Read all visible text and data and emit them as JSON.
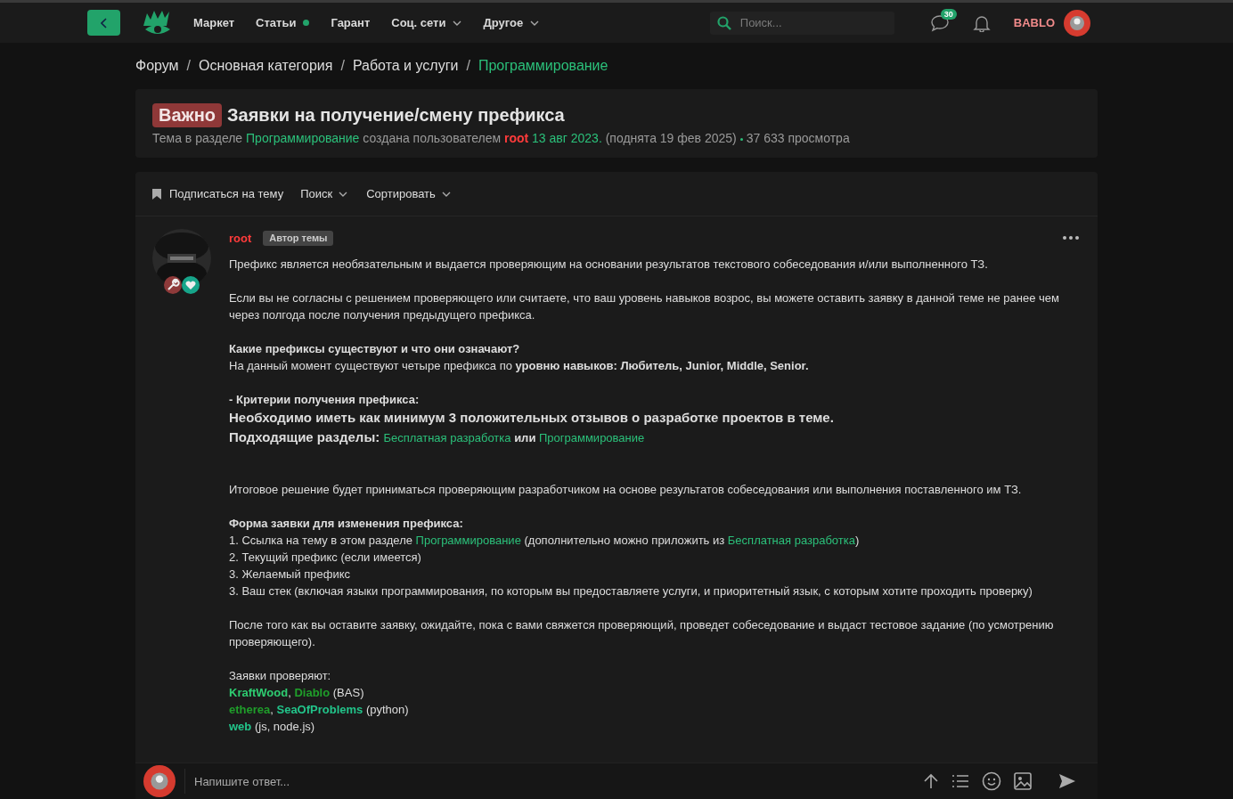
{
  "header": {
    "nav": [
      {
        "label": "Маркет",
        "dot": false,
        "dropdown": false
      },
      {
        "label": "Статьи",
        "dot": true,
        "dropdown": false
      },
      {
        "label": "Гарант",
        "dot": false,
        "dropdown": false
      },
      {
        "label": "Соц. сети",
        "dot": false,
        "dropdown": true
      },
      {
        "label": "Другое",
        "dot": false,
        "dropdown": true
      }
    ],
    "search": {
      "placeholder": "Поиск..."
    },
    "messages_badge": "30",
    "username": "BABLO"
  },
  "breadcrumbs": [
    {
      "label": "Форум",
      "kind": "link",
      "current": false
    },
    {
      "label": "/",
      "kind": "separator"
    },
    {
      "label": "Основная категория",
      "kind": "link",
      "current": false
    },
    {
      "label": "/",
      "kind": "separator"
    },
    {
      "label": "Работа и услуги",
      "kind": "link",
      "current": false
    },
    {
      "label": "/",
      "kind": "separator"
    },
    {
      "label": "Программирование",
      "kind": "link",
      "current": true
    }
  ],
  "topic": {
    "prefix": "Важно",
    "title": "Заявки на получение/смену префикса",
    "meta": [
      {
        "t": "Тема в разделе ",
        "kind": "text"
      },
      {
        "t": "Программирование",
        "kind": "link"
      },
      {
        "t": " создана пользователем ",
        "kind": "text"
      },
      {
        "t": "root",
        "kind": "user",
        "color": "#ff3b3b"
      },
      {
        "t": " 13 авг 2023.",
        "kind": "link"
      },
      {
        "t": " (поднята 19 фев 2025)",
        "kind": "text"
      }
    ],
    "views": "37 633 просмотра"
  },
  "toolbar": [
    {
      "label": "Подписаться на тему",
      "kind": "bookmark"
    },
    {
      "label": "Поиск",
      "kind": "dropdown"
    },
    {
      "label": "Сортировать",
      "kind": "dropdown"
    }
  ],
  "post": {
    "author": "root",
    "author_badge": "Автор темы",
    "body": [
      [
        [
          {
            "t": "Префикс является необязательным и выдается проверяющим на основании результатов текстового собеседования и/или выполненного ТЗ.",
            "kind": "text"
          }
        ]
      ],
      [
        [
          {
            "t": "Если вы не согласны с решением проверяющего или считаете, что ваш уровень навыков возрос, вы можете оставить заявку в данной теме не ранее чем через полгода после получения предыдущего префикса.",
            "kind": "text"
          }
        ]
      ],
      [
        [
          {
            "t": "Какие префиксы существуют и что они означают?",
            "kind": "bold"
          }
        ],
        [
          {
            "t": "На данный момент существуют четыре префикса по ",
            "kind": "text"
          },
          {
            "t": "уровню навыков: Любитель, Junior, Middle, Senior.",
            "kind": "bold"
          }
        ]
      ],
      [
        [
          {
            "t": "- Критерии получения префикса:",
            "kind": "bold"
          }
        ],
        [
          {
            "t": "Необходимо иметь как минимум 3 положительных отзывов о разработке проектов в теме.",
            "kind": "big"
          }
        ],
        [
          {
            "t": "Подходящие разделы: ",
            "kind": "big"
          },
          {
            "t": "Бесплатная разработка",
            "kind": "link"
          },
          {
            "t": " или ",
            "kind": "bold"
          },
          {
            "t": "Программирование",
            "kind": "link"
          }
        ]
      ],
      [
        [
          {
            "t": "Итоговое решение будет приниматься проверяющим разработчиком на основе результатов собеседования или выполнения поставленного им ТЗ.",
            "kind": "text"
          }
        ]
      ],
      [
        [
          {
            "t": "Форма заявки для изменения префикса:",
            "kind": "bold"
          }
        ],
        [
          {
            "t": "1. Ссылка на тему в этом разделе ",
            "kind": "text"
          },
          {
            "t": "Программирование",
            "kind": "link"
          },
          {
            "t": " (дополнительно можно приложить из ",
            "kind": "text"
          },
          {
            "t": "Бесплатная разработка",
            "kind": "link"
          },
          {
            "t": ")",
            "kind": "text"
          }
        ],
        [
          {
            "t": "2. Текущий префикс (если имеется)",
            "kind": "text"
          }
        ],
        [
          {
            "t": "3. Желаемый префикс",
            "kind": "text"
          }
        ],
        [
          {
            "t": "3. Ваш стек (включая языки программирования, по которым вы предоставляете услуги, и приоритетный язык, с которым хотите проходить проверку)",
            "kind": "text"
          }
        ]
      ],
      [
        [
          {
            "t": "После того как вы оставите заявку, ожидайте, пока с вами свяжется проверяющий, проведет собеседование и выдаст тестовое задание (по усмотрению проверяющего).",
            "kind": "text"
          }
        ]
      ],
      [
        [
          {
            "t": "Заявки проверяют:",
            "kind": "text"
          }
        ],
        [
          {
            "t": "KraftWood",
            "kind": "user",
            "color": "#2ecc71"
          },
          {
            "t": ", ",
            "kind": "text"
          },
          {
            "t": "Diablo",
            "kind": "user",
            "color": "#1f9e2a"
          },
          {
            "t": " (BAS)",
            "kind": "text"
          }
        ],
        [
          {
            "t": "etherea",
            "kind": "user",
            "color": "#1f9e2a"
          },
          {
            "t": ", ",
            "kind": "text"
          },
          {
            "t": "SeaOfProblems",
            "kind": "user",
            "color": "#22c48a"
          },
          {
            "t": " (python)",
            "kind": "text"
          }
        ],
        [
          {
            "t": "web",
            "kind": "user",
            "color": "#22c48a"
          },
          {
            "t": " (js, node.js)",
            "kind": "text"
          }
        ]
      ]
    ]
  },
  "reply": {
    "placeholder": "Напишите ответ..."
  }
}
